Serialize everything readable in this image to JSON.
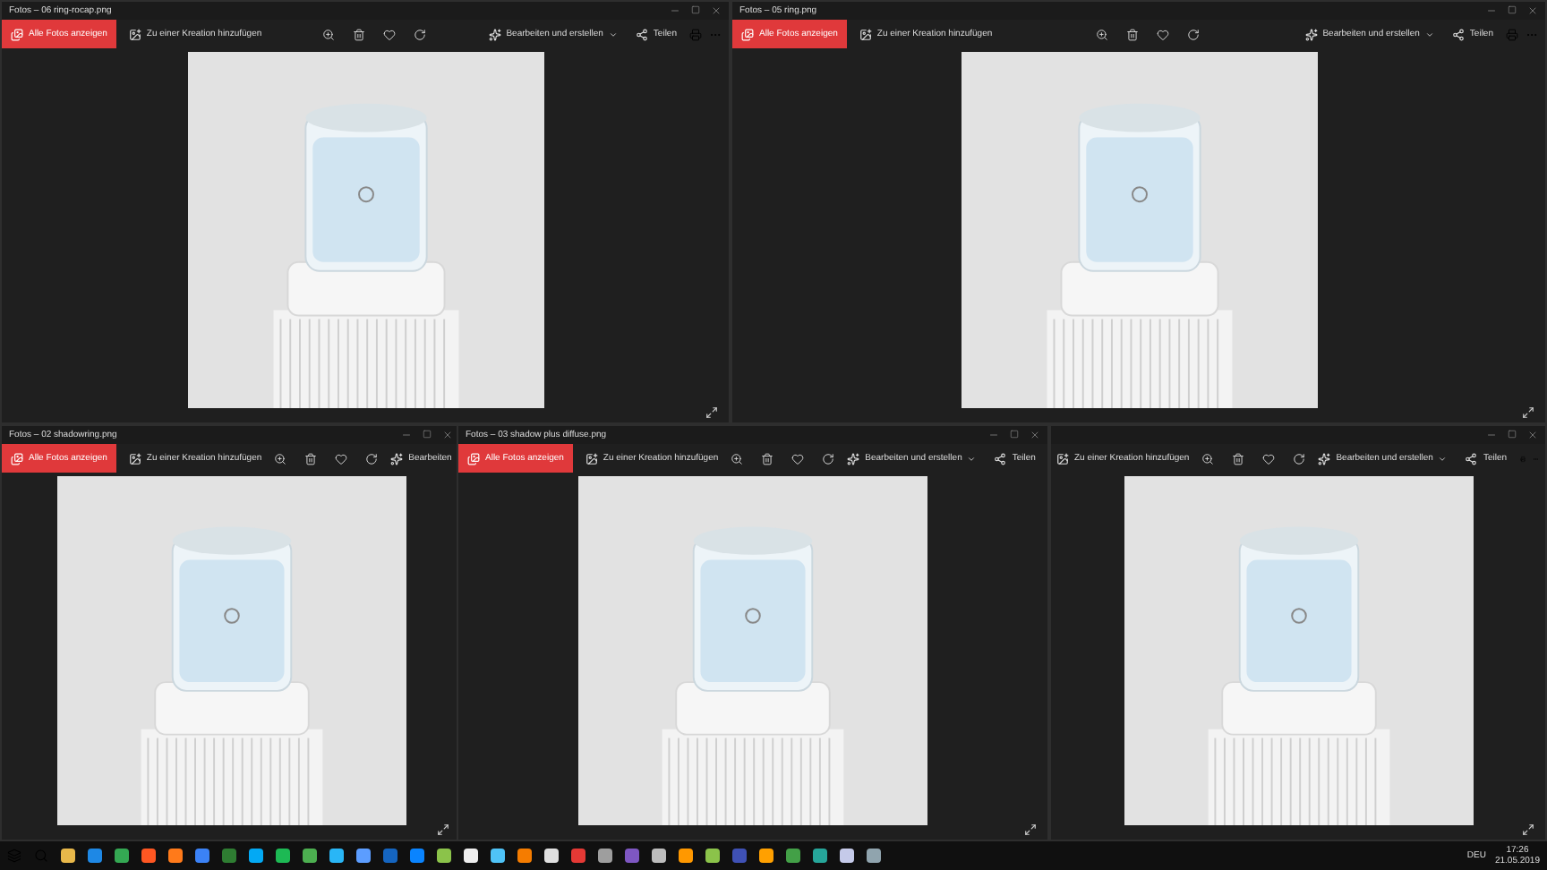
{
  "windows": [
    {
      "title": "Fotos – 06 ring-rocap.png",
      "all_photos": "Alle Fotos anzeigen",
      "add_to_creation": "Zu einer Kreation hinzufügen",
      "edit": "Bearbeiten und erstellen",
      "share": "Teilen"
    },
    {
      "title": "Fotos – 05 ring.png",
      "all_photos": "Alle Fotos anzeigen",
      "add_to_creation": "Zu einer Kreation hinzufügen",
      "edit": "Bearbeiten und erstellen",
      "share": "Teilen"
    },
    {
      "title": "Fotos – 02 shadowring.png",
      "all_photos": "Alle Fotos anzeigen",
      "add_to_creation": "Zu einer Kreation hinzufügen",
      "edit": "Bearbeiten"
    },
    {
      "title": "Fotos – 03 shadow plus diffuse.png",
      "all_photos": "Alle Fotos anzeigen",
      "add_to_creation": "Zu einer Kreation hinzufügen",
      "edit": "Bearbeiten und erstellen",
      "share": "Teilen"
    },
    {
      "add_to_creation": "Zu einer Kreation hinzufügen",
      "edit": "Bearbeiten und erstellen",
      "share": "Teilen"
    }
  ],
  "taskbar": {
    "language": "DEU",
    "time": "17:26",
    "date": "21.05.2019"
  }
}
